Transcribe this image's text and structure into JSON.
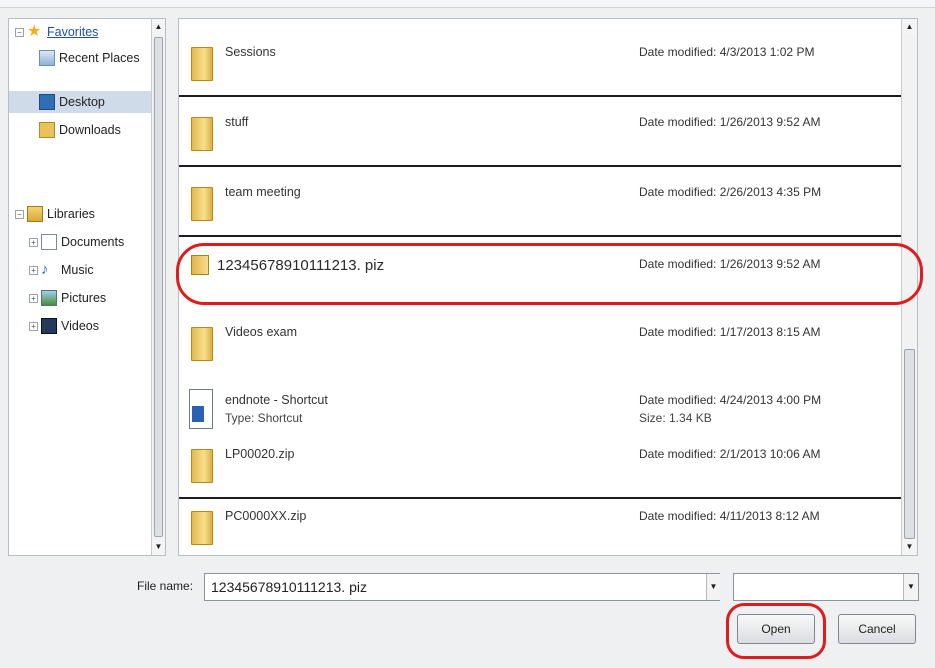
{
  "nav": {
    "favorites": "Favorites",
    "recent_places": "Recent Places",
    "desktop": "Desktop",
    "downloads": "Downloads",
    "libraries": "Libraries",
    "documents": "Documents",
    "music": "Music",
    "pictures": "Pictures",
    "videos": "Videos",
    "selected": "Desktop"
  },
  "files": [
    {
      "name": "Sessions",
      "date": "Date modified: 4/3/2013 1:02 PM",
      "icon": "folder-icon"
    },
    {
      "name": "stuff",
      "date": "Date modified: 1/26/2013 9:52 AM",
      "icon": "folder-icon"
    },
    {
      "name": "team meeting",
      "date": "Date modified: 2/26/2013 4:35 PM",
      "icon": "folder-icon"
    },
    {
      "name": "12345678910111213. piz",
      "date": "Date modified: 1/26/2013 9:52 AM",
      "icon": "zip-icon",
      "highlighted": true
    },
    {
      "name": "Videos exam",
      "date": "Date modified: 1/17/2013 8:15 AM",
      "icon": "folder-icon"
    },
    {
      "name": "endnote - Shortcut",
      "sub": "Type: Shortcut",
      "date": "Date modified: 4/24/2013 4:00 PM",
      "size": "Size: 1.34 KB",
      "icon": "document-icon"
    },
    {
      "name": "LP00020.zip",
      "date": "Date modified: 2/1/2013 10:06 AM",
      "icon": "zip-folder-icon"
    },
    {
      "name": "PC0000XX.zip",
      "date": "Date modified: 4/11/2013 8:12 AM",
      "icon": "zip-folder-icon"
    }
  ],
  "bottom": {
    "file_name_label": "File name:",
    "file_name_value": "12345678910111213. piz",
    "filter_value": "",
    "open_label": "Open",
    "cancel_label": "Cancel"
  },
  "colors": {
    "highlight_ring": "#e01b1b",
    "nav_selected": "#cfdbe8"
  }
}
